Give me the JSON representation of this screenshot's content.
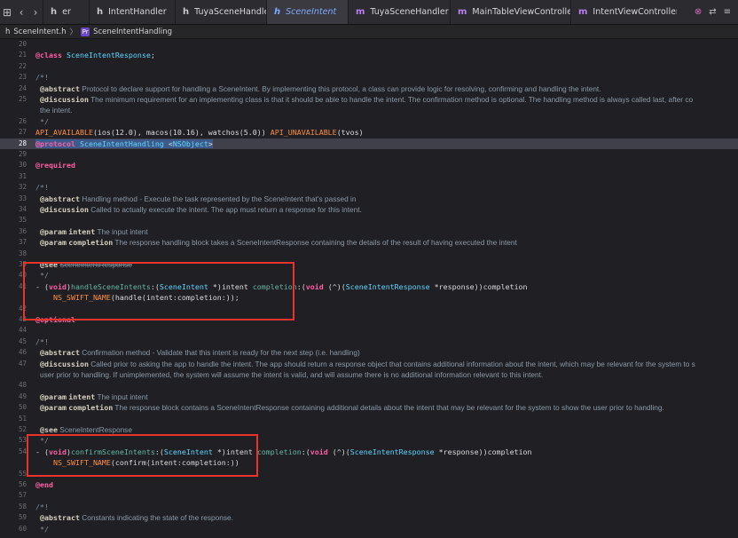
{
  "tabs": [
    {
      "icon": "h",
      "label": "er",
      "icon_type": "header"
    },
    {
      "icon": "h",
      "label": "IntentHandler",
      "icon_type": "header"
    },
    {
      "icon": "h",
      "label": "TuyaSceneHandler",
      "icon_type": "header"
    },
    {
      "icon": "h",
      "label": "SceneIntent",
      "icon_type": "header",
      "active": true
    },
    {
      "icon": "m",
      "label": "TuyaSceneHandler",
      "icon_type": "implementation"
    },
    {
      "icon": "m",
      "label": "MainTableViewController",
      "icon_type": "implementation"
    },
    {
      "icon": "m",
      "label": "IntentViewController",
      "icon_type": "implementation"
    }
  ],
  "breadcrumb": {
    "file": "SceneIntent.h",
    "symbol": "SceneIntentHandling",
    "file_icon": "h",
    "symbol_badge": "Pr"
  },
  "lines": [
    {
      "n": "20",
      "text": ""
    },
    {
      "n": "21",
      "text": "@class SceneIntentResponse;"
    },
    {
      "n": "22",
      "text": ""
    },
    {
      "n": "23",
      "text": "/*!"
    },
    {
      "n": "24",
      "key": "@abstract",
      "body": "Protocol to declare support for handling a SceneIntent. By implementing this protocol, a class can provide logic for resolving, confirming and handling the intent."
    },
    {
      "n": "25",
      "key": "@discussion",
      "body": "The minimum requirement for an implementing class is that it should be able to handle the intent. The confirmation method is optional. The handling method is always called last, after co"
    },
    {
      "n": "",
      "body": "the intent."
    },
    {
      "n": "26",
      "text": " */"
    },
    {
      "n": "27",
      "text": "API_AVAILABLE(ios(12.0), macos(10.16), watchos(5.0)) API_UNAVAILABLE(tvos)"
    },
    {
      "n": "28",
      "text": "@protocol SceneIntentHandling <NSObject>"
    },
    {
      "n": "29",
      "text": ""
    },
    {
      "n": "30",
      "text": "@required"
    },
    {
      "n": "31",
      "text": ""
    },
    {
      "n": "32",
      "text": "/*!"
    },
    {
      "n": "33",
      "key": "@abstract",
      "body": "Handling method - Execute the task represented by the SceneIntent that's passed in"
    },
    {
      "n": "34",
      "key": "@discussion",
      "body": "Called to actually execute the intent. The app must return a response for this intent."
    },
    {
      "n": "35",
      "text": ""
    },
    {
      "n": "36",
      "key": "@param",
      "param": "intent",
      "body": "The input intent"
    },
    {
      "n": "37",
      "key": "@param",
      "param": "completion",
      "body": "The response handling block takes a SceneIntentResponse containing the details of the result of having executed the intent"
    },
    {
      "n": "38",
      "text": ""
    },
    {
      "n": "39",
      "key": "@see",
      "body": "SceneIntentResponse"
    },
    {
      "n": "40",
      "text": " */"
    },
    {
      "n": "41",
      "text": "- (void)handleSceneIntents:(SceneIntent *)intent completion:(void (^)(SceneIntentResponse *response))completion"
    },
    {
      "n": "",
      "text": "    NS_SWIFT_NAME(handle(intent:completion:));"
    },
    {
      "n": "42",
      "text": ""
    },
    {
      "n": "43",
      "text": "@optional"
    },
    {
      "n": "44",
      "text": ""
    },
    {
      "n": "45",
      "text": "/*!"
    },
    {
      "n": "46",
      "key": "@abstract",
      "body": "Confirmation method - Validate that this intent is ready for the next step (i.e. handling)"
    },
    {
      "n": "47",
      "key": "@discussion",
      "body": "Called prior to asking the app to handle the intent. The app should return a response object that contains additional information about the intent, which may be relevant for the system to s"
    },
    {
      "n": "",
      "body": "user prior to handling. If unimplemented, the system will assume the intent is valid, and will assume there is no additional information relevant to this intent."
    },
    {
      "n": "48",
      "text": ""
    },
    {
      "n": "49",
      "key": "@param",
      "param": "intent",
      "body": "The input intent"
    },
    {
      "n": "50",
      "key": "@param",
      "param": "completion",
      "body": "The response block contains a SceneIntentResponse containing additional details about the intent that may be relevant for the system to show the user prior to handling."
    },
    {
      "n": "51",
      "text": ""
    },
    {
      "n": "52",
      "key": "@see",
      "body": "SceneIntentResponse"
    },
    {
      "n": "53",
      "text": " */"
    },
    {
      "n": "54",
      "text": "- (void)confirmSceneIntents:(SceneIntent *)intent completion:(void (^)(SceneIntentResponse *response))completion"
    },
    {
      "n": "",
      "text": "    NS_SWIFT_NAME(confirm(intent:completion:))"
    },
    {
      "n": "55",
      "text": ""
    },
    {
      "n": "56",
      "text": "@end"
    },
    {
      "n": "57",
      "text": ""
    },
    {
      "n": "58",
      "text": "/*!"
    },
    {
      "n": "59",
      "key": "@abstract",
      "body": "Constants indicating the state of the response."
    },
    {
      "n": "60",
      "text": " */"
    }
  ],
  "colors": {
    "highlight_box": "#e8342c",
    "keyword": "#fc5fa3",
    "type": "#5dd8ff",
    "method": "#67b7a4",
    "macro": "#fd8f3f"
  }
}
